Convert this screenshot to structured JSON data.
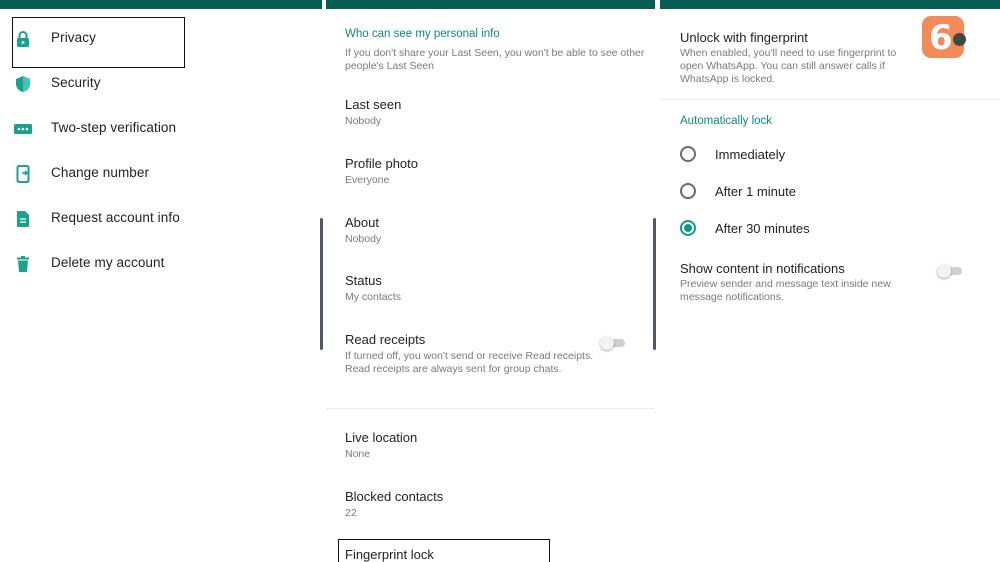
{
  "colors": {
    "header": "#075e54",
    "accent": "#0e8a7d"
  },
  "left_menu": {
    "items": [
      {
        "label": "Privacy",
        "icon": "lock-icon"
      },
      {
        "label": "Security",
        "icon": "shield-icon"
      },
      {
        "label": "Two-step verification",
        "icon": "dots-icon"
      },
      {
        "label": "Change number",
        "icon": "phone-change-icon"
      },
      {
        "label": "Request account info",
        "icon": "document-icon"
      },
      {
        "label": "Delete my account",
        "icon": "trash-icon"
      }
    ]
  },
  "privacy": {
    "section_title": "Who can see my personal info",
    "section_hint": "If you don't share your Last Seen, you won't be able to see other people's Last Seen",
    "items": [
      {
        "title": "Last seen",
        "value": "Nobody"
      },
      {
        "title": "Profile photo",
        "value": "Everyone"
      },
      {
        "title": "About",
        "value": "Nobody"
      },
      {
        "title": "Status",
        "value": "My contacts"
      }
    ],
    "read_receipts": {
      "title": "Read receipts",
      "description": "If turned off, you won't send or receive Read receipts. Read receipts are always sent for group chats."
    },
    "more_items": [
      {
        "title": "Live location",
        "value": "None"
      },
      {
        "title": "Blocked contacts",
        "value": "22"
      }
    ],
    "fingerprint_lock": "Fingerprint lock"
  },
  "fingerprint": {
    "unlock_title": "Unlock with fingerprint",
    "unlock_description": "When enabled, you'll need to use fingerprint to open WhatsApp. You can still answer calls if WhatsApp is locked.",
    "auto_lock_title": "Automatically lock",
    "options": [
      "Immediately",
      "After 1 minute",
      "After 30 minutes"
    ],
    "selected_option": "After 30 minutes",
    "show_content_title": "Show content in notifications",
    "show_content_description": "Preview sender and message text inside new message notifications.",
    "logo_text": "6"
  }
}
